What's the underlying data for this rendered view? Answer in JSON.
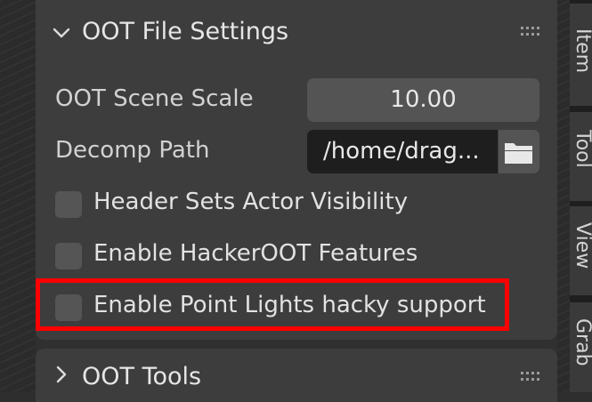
{
  "file_settings": {
    "header_title": "OOT File Settings",
    "scene_scale_label": "OOT Scene Scale",
    "scene_scale_value": "10.00",
    "decomp_path_label": "Decomp Path",
    "decomp_path_value": "/home/drag...",
    "checkboxes": [
      {
        "label": "Header Sets Actor Visibility",
        "checked": false
      },
      {
        "label": "Enable HackerOOT Features",
        "checked": false
      },
      {
        "label": "Enable Point Lights hacky support",
        "checked": false
      }
    ]
  },
  "oot_tools": {
    "header_title": "OOT Tools"
  },
  "sidebar_tabs": [
    "Item",
    "Tool",
    "View",
    "Grab"
  ],
  "colors": {
    "highlight": "#ff0000",
    "panel_bg": "#3d3d3d",
    "field_bg": "#545454",
    "path_field_bg": "#1e1e1e"
  },
  "icons": {
    "collapse": "chevron-down-icon",
    "expand": "chevron-right-icon",
    "drag": "grip-icon",
    "browse": "folder-icon"
  }
}
